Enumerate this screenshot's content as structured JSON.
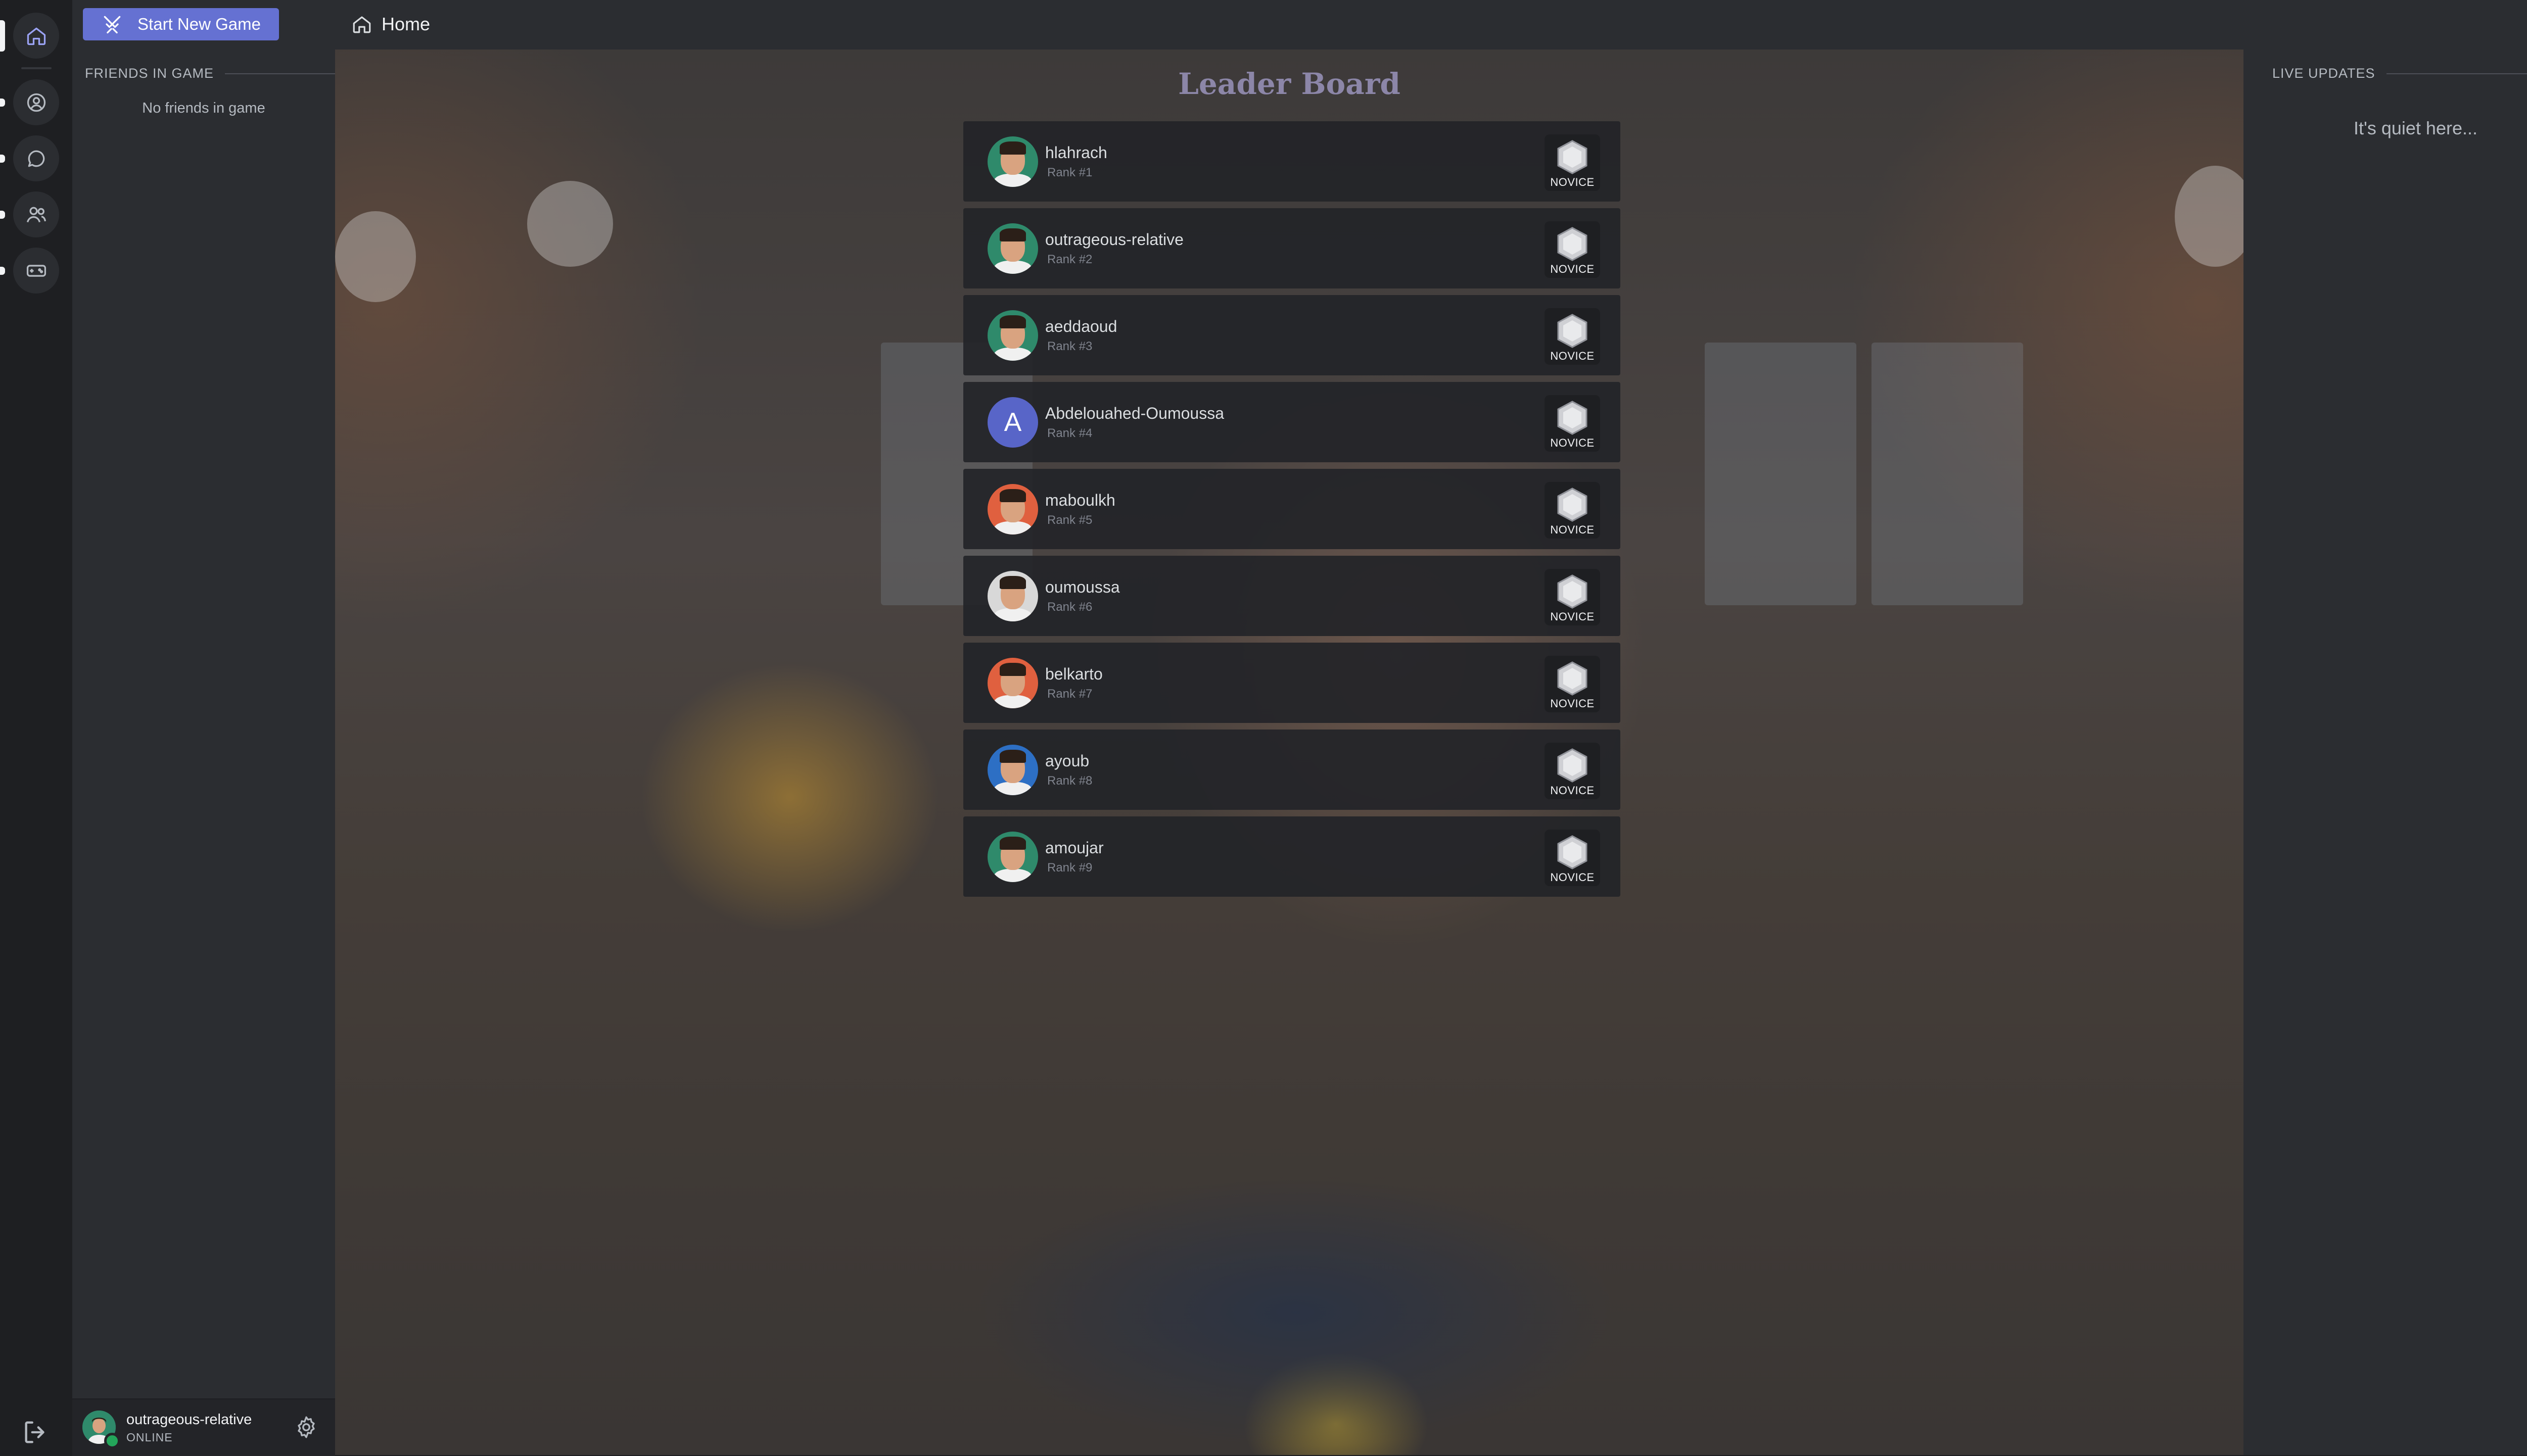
{
  "rail": {
    "items": [
      {
        "icon": "home-icon",
        "active": true
      },
      {
        "icon": "user-circle-icon"
      },
      {
        "icon": "chat-bubble-icon"
      },
      {
        "icon": "users-icon"
      },
      {
        "icon": "gamepad-icon"
      }
    ],
    "logout_icon": "logout-icon"
  },
  "topbar": {
    "start_button_label": "Start New Game",
    "start_button_icon": "crossed-swords-icon",
    "breadcrumb_label": "Home",
    "breadcrumb_icon": "home-icon"
  },
  "left_panel": {
    "friends_heading": "FRIENDS IN GAME",
    "friends_empty": "No friends in game",
    "user": {
      "name": "outrageous-relative",
      "status": "ONLINE"
    }
  },
  "leaderboard": {
    "title": "Leader Board",
    "players": [
      {
        "username": "hlahrach",
        "rank": "Rank #1",
        "tier": "NOVICE",
        "avatar_bg": "#2f8a6b"
      },
      {
        "username": "outrageous-relative",
        "rank": "Rank #2",
        "tier": "NOVICE",
        "avatar_bg": "#2f8a6b"
      },
      {
        "username": "aeddaoud",
        "rank": "Rank #3",
        "tier": "NOVICE",
        "avatar_bg": "#2f8a6b"
      },
      {
        "username": "Abdelouahed-Oumoussa",
        "rank": "Rank #4",
        "tier": "NOVICE",
        "avatar_bg": "#5865c8",
        "initial": "A"
      },
      {
        "username": "maboulkh",
        "rank": "Rank #5",
        "tier": "NOVICE",
        "avatar_bg": "#e0603f"
      },
      {
        "username": "oumoussa",
        "rank": "Rank #6",
        "tier": "NOVICE",
        "avatar_bg": "#d8d8d8"
      },
      {
        "username": "belkarto",
        "rank": "Rank #7",
        "tier": "NOVICE",
        "avatar_bg": "#e0603f"
      },
      {
        "username": "ayoub",
        "rank": "Rank #8",
        "tier": "NOVICE",
        "avatar_bg": "#2d6fc4"
      },
      {
        "username": "amoujar",
        "rank": "Rank #9",
        "tier": "NOVICE",
        "avatar_bg": "#2f8a6b"
      }
    ]
  },
  "right_panel": {
    "heading": "LIVE UPDATES",
    "empty": "It's quiet here..."
  },
  "colors": {
    "accent": "#6571d2",
    "panel": "#2b2d31",
    "rail": "#1e1f22",
    "online": "#23a55a",
    "title": "#8c86a8"
  }
}
